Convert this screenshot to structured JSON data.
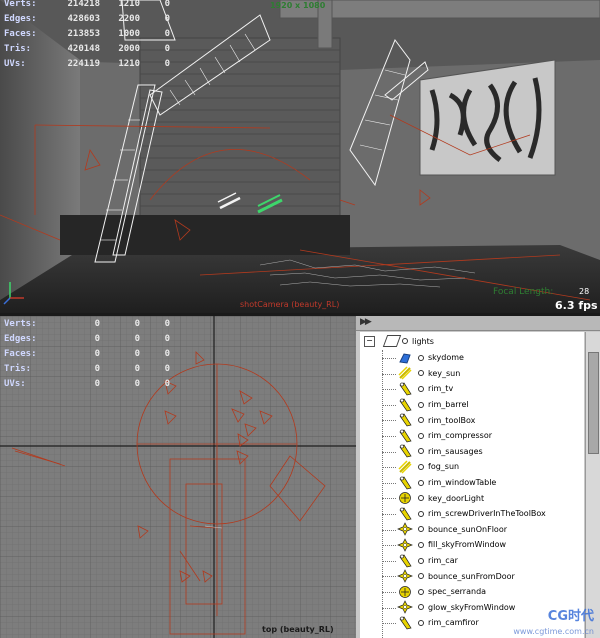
{
  "perspective": {
    "hud": [
      {
        "label": "Verts:",
        "v1": "214218",
        "v2": "1210",
        "v3": "0"
      },
      {
        "label": "Edges:",
        "v1": "428603",
        "v2": "2200",
        "v3": "0"
      },
      {
        "label": "Faces:",
        "v1": "213853",
        "v2": "1000",
        "v3": "0"
      },
      {
        "label": "Tris:",
        "v1": "420148",
        "v2": "2000",
        "v3": "0"
      },
      {
        "label": "UVs:",
        "v1": "224119",
        "v2": "1210",
        "v3": "0"
      }
    ],
    "resolution": "1920 x 1080",
    "camera_label": "shotCamera (beauty_RL)",
    "focal_label": "Focal Length:",
    "focal_value": "28",
    "fps": "6.3 fps"
  },
  "top_view": {
    "hud": [
      {
        "label": "Verts:",
        "v1": "0",
        "v2": "0",
        "v3": "0"
      },
      {
        "label": "Edges:",
        "v1": "0",
        "v2": "0",
        "v3": "0"
      },
      {
        "label": "Faces:",
        "v1": "0",
        "v2": "0",
        "v3": "0"
      },
      {
        "label": "Tris:",
        "v1": "0",
        "v2": "0",
        "v3": "0"
      },
      {
        "label": "UVs:",
        "v1": "0",
        "v2": "0",
        "v3": "0"
      }
    ],
    "camera_label": "top (beauty_RL)"
  },
  "outliner": {
    "root": "lights",
    "items": [
      {
        "name": "skydome",
        "icon": "dome-light-icon"
      },
      {
        "name": "key_sun",
        "icon": "directional-light-icon"
      },
      {
        "name": "rim_tv",
        "icon": "spot-light-icon"
      },
      {
        "name": "rim_barrel",
        "icon": "spot-light-icon"
      },
      {
        "name": "rim_toolBox",
        "icon": "spot-light-icon"
      },
      {
        "name": "rim_compressor",
        "icon": "spot-light-icon"
      },
      {
        "name": "rim_sausages",
        "icon": "spot-light-icon"
      },
      {
        "name": "fog_sun",
        "icon": "directional-light-icon"
      },
      {
        "name": "rim_windowTable",
        "icon": "spot-light-icon"
      },
      {
        "name": "key_doorLight",
        "icon": "point-light-icon"
      },
      {
        "name": "rim_screwDriverInTheToolBox",
        "icon": "spot-light-icon"
      },
      {
        "name": "bounce_sunOnFloor",
        "icon": "area-light-icon"
      },
      {
        "name": "fill_skyFromWindow",
        "icon": "area-light-icon"
      },
      {
        "name": "rim_car",
        "icon": "spot-light-icon"
      },
      {
        "name": "bounce_sunFromDoor",
        "icon": "area-light-icon"
      },
      {
        "name": "spec_serranda",
        "icon": "point-light-icon"
      },
      {
        "name": "glow_skyFromWindow",
        "icon": "area-light-icon"
      },
      {
        "name": "rim_camfiror",
        "icon": "spot-light-icon"
      }
    ]
  },
  "watermark": {
    "brand": "CG时代",
    "url": "www.cgtime.com.cn"
  },
  "colors": {
    "wire_red": "#b23a1e",
    "wire_white": "#f2f2f2",
    "selected_green": "#3dd66b",
    "light_yellow": "#e8d400"
  }
}
